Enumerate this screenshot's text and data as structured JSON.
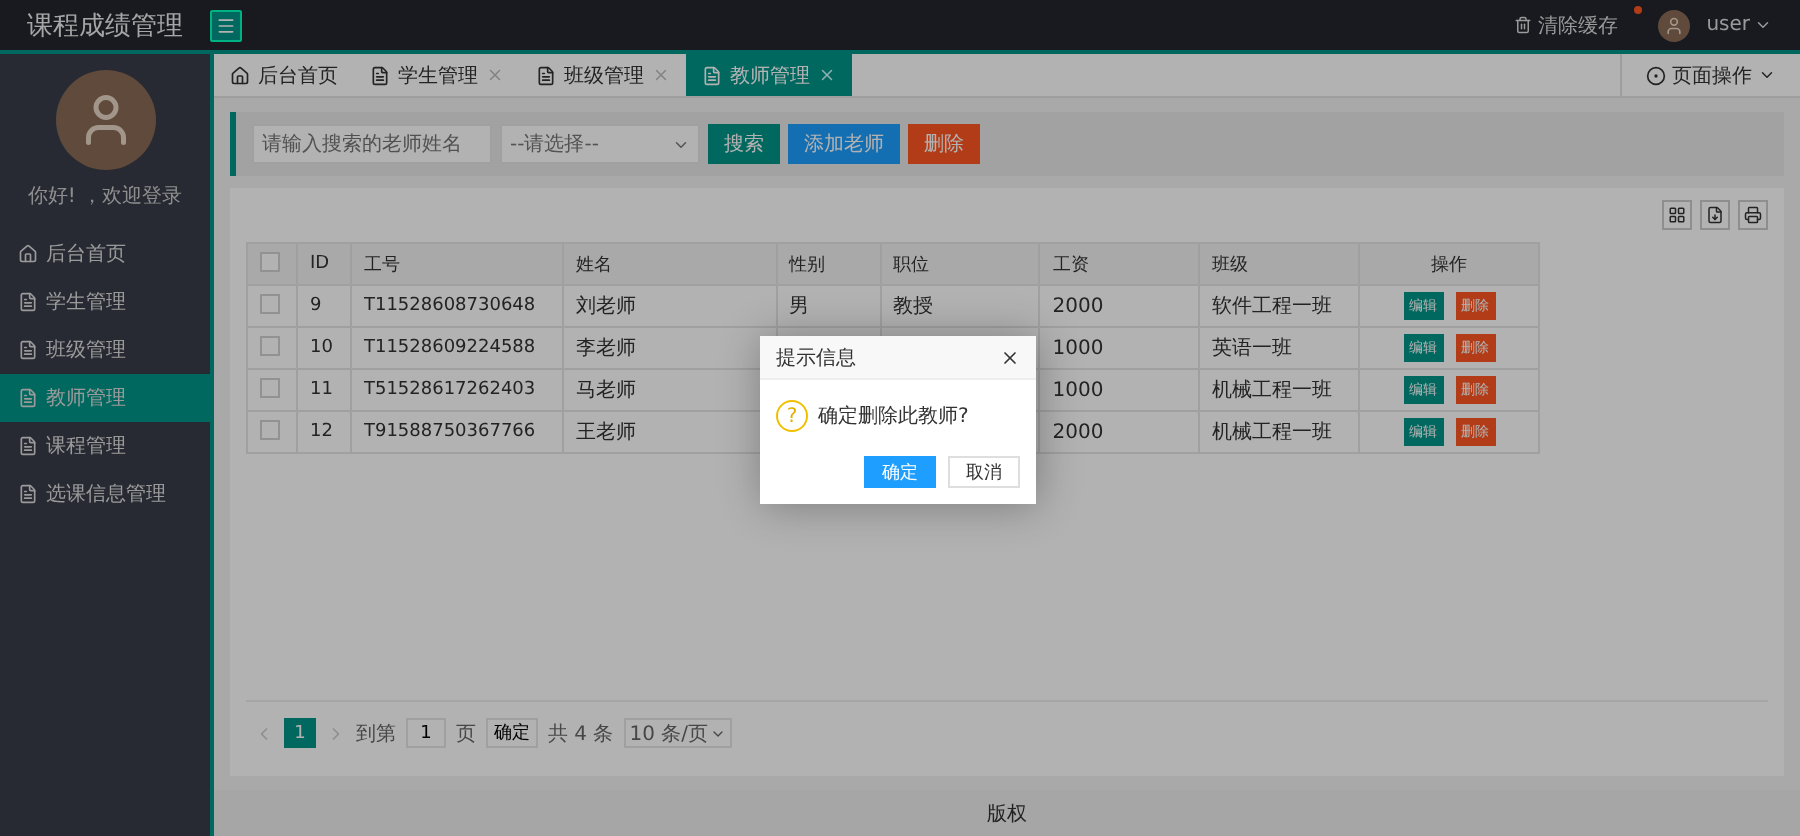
{
  "header": {
    "title": "课程成绩管理",
    "clear_cache": "清除缓存",
    "user": "user"
  },
  "sidebar": {
    "greeting": "你好! ，欢迎登录",
    "items": [
      {
        "label": "后台首页",
        "kind": "home",
        "selected": false
      },
      {
        "label": "学生管理",
        "kind": "page",
        "selected": false
      },
      {
        "label": "班级管理",
        "kind": "page",
        "selected": false
      },
      {
        "label": "教师管理",
        "kind": "page",
        "selected": true
      },
      {
        "label": "课程管理",
        "kind": "page",
        "selected": false
      },
      {
        "label": "选课信息管理",
        "kind": "page",
        "selected": false
      }
    ]
  },
  "tabs": [
    {
      "label": "后台首页",
      "kind": "home",
      "closable": false,
      "selected": false
    },
    {
      "label": "学生管理",
      "kind": "page",
      "closable": true,
      "selected": false
    },
    {
      "label": "班级管理",
      "kind": "page",
      "closable": true,
      "selected": false
    },
    {
      "label": "教师管理",
      "kind": "page",
      "closable": true,
      "selected": true
    }
  ],
  "page_actions": "页面操作",
  "search": {
    "placeholder": "请输入搜索的老师姓名",
    "select_placeholder": "--请选择--",
    "buttons": [
      {
        "label": "搜索",
        "kind": "primary"
      },
      {
        "label": "添加老师",
        "kind": "normal"
      },
      {
        "label": "删除",
        "kind": "danger"
      }
    ]
  },
  "table": {
    "header_checked": false,
    "columns": [
      "ID",
      "工号",
      "姓名",
      "性别",
      "职位",
      "工资",
      "班级",
      "操作"
    ],
    "rows": [
      {
        "checked": false,
        "cells": [
          "9",
          "T11528608730648",
          "刘老师",
          "男",
          "教授",
          "2000",
          "软件工程一班"
        ],
        "actions": [
          "编辑",
          "删除"
        ]
      },
      {
        "checked": false,
        "cells": [
          "10",
          "T11528609224588",
          "李老师",
          "",
          "",
          "1000",
          "英语一班"
        ],
        "actions": [
          "编辑",
          "删除"
        ]
      },
      {
        "checked": false,
        "cells": [
          "11",
          "T51528617262403",
          "马老师",
          "",
          "",
          "1000",
          "机械工程一班"
        ],
        "actions": [
          "编辑",
          "删除"
        ]
      },
      {
        "checked": false,
        "cells": [
          "12",
          "T91588750367766",
          "王老师",
          "",
          "",
          "2000",
          "机械工程一班"
        ],
        "actions": [
          "编辑",
          "删除"
        ]
      }
    ]
  },
  "pagination": {
    "pages": [
      {
        "label": "1",
        "selected": true
      }
    ],
    "goto_label": "到第",
    "goto_value": "1",
    "page_unit": "页",
    "confirm": "确定",
    "total": "共 4 条",
    "page_size": "10 条/页"
  },
  "footer": "版权",
  "dialog": {
    "title": "提示信息",
    "icon": "?",
    "message": "确定删除此教师?",
    "confirm": "确定",
    "cancel": "取消"
  }
}
